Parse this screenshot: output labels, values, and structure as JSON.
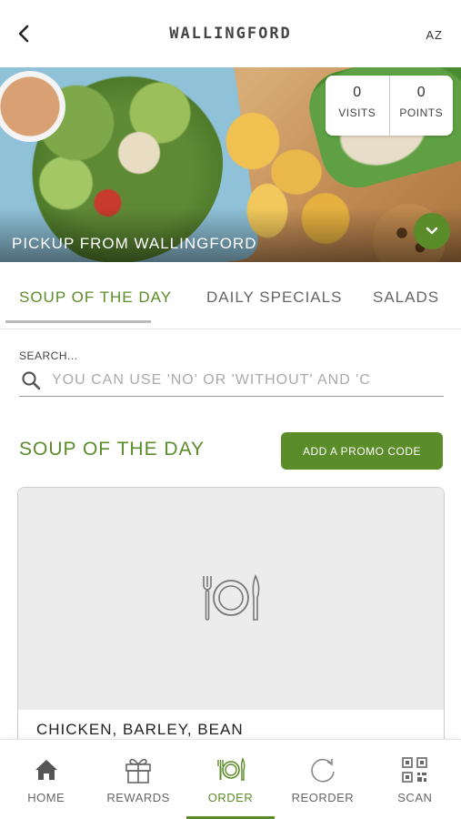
{
  "header": {
    "title": "WALLINGFORD",
    "right_label": "AZ",
    "back_icon": "chevron-left-icon"
  },
  "hero": {
    "pickup_label": "PICKUP FROM WALLINGFORD",
    "stats": {
      "visits_value": "0",
      "visits_label": "VISITS",
      "points_value": "0",
      "points_label": "POINTS"
    },
    "expand_icon": "chevron-down-icon"
  },
  "tabs": [
    {
      "label": "SOUP OF THE DAY",
      "active": true
    },
    {
      "label": "DAILY SPECIALS",
      "active": false
    },
    {
      "label": "SALADS",
      "active": false
    }
  ],
  "search": {
    "label": "SEARCH...",
    "placeholder": "YOU CAN USE 'NO' OR 'WITHOUT' AND 'C",
    "value": ""
  },
  "section": {
    "title": "SOUP OF THE DAY",
    "promo_button": "ADD A PROMO CODE"
  },
  "menu_items": [
    {
      "name": "CHICKEN, BARLEY, BEAN",
      "image_icon": "plate-utensils-icon"
    }
  ],
  "bottom_nav": [
    {
      "label": "HOME",
      "icon": "home-icon",
      "active": false
    },
    {
      "label": "REWARDS",
      "icon": "gift-icon",
      "active": false
    },
    {
      "label": "ORDER",
      "icon": "plate-utensils-icon",
      "active": true
    },
    {
      "label": "REORDER",
      "icon": "refresh-icon",
      "active": false
    },
    {
      "label": "SCAN",
      "icon": "qr-code-icon",
      "active": false
    }
  ],
  "colors": {
    "brand_green": "#5b8c2a",
    "inactive_text": "#666666",
    "placeholder": "#aaaaaa"
  }
}
